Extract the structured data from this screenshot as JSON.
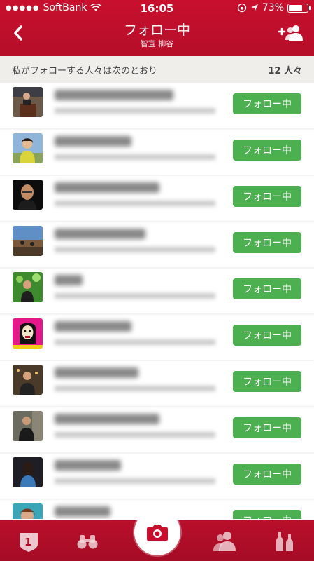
{
  "status_bar": {
    "carrier": "SoftBank",
    "time": "16:05",
    "battery": "73%",
    "battery_level": 0.73
  },
  "nav": {
    "title": "フォロー中",
    "subtitle": "智宣 柳谷",
    "back_icon": "chevron-left-icon",
    "add_icon": "add-user-icon"
  },
  "summary": {
    "text": "私がフォローする人々は次のとおり",
    "count": "12 人々"
  },
  "users": [
    {
      "name": "",
      "meta": "",
      "button": "フォロー中"
    },
    {
      "name": "",
      "meta": "",
      "button": "フォロー中"
    },
    {
      "name": "",
      "meta": "",
      "button": "フォロー中"
    },
    {
      "name": "",
      "meta": "",
      "button": "フォロー中"
    },
    {
      "name": "",
      "meta": "",
      "button": "フォロー中"
    },
    {
      "name": "",
      "meta": "",
      "button": "フォロー中"
    },
    {
      "name": "",
      "meta": "",
      "button": "フォロー中"
    },
    {
      "name": "",
      "meta": "",
      "button": "フォロー中"
    },
    {
      "name": "",
      "meta": "",
      "button": "フォロー中"
    },
    {
      "name": "",
      "meta": "",
      "button": "フォロー中"
    }
  ],
  "tabbar": {
    "items": [
      "ranking-icon",
      "binoculars-icon",
      "camera-icon",
      "friends-icon",
      "wine-bottles-icon"
    ],
    "badge": "1"
  },
  "colors": {
    "brand_red": "#c8102e",
    "follow_green": "#4caf50",
    "summary_bg": "#f0eeeb"
  }
}
